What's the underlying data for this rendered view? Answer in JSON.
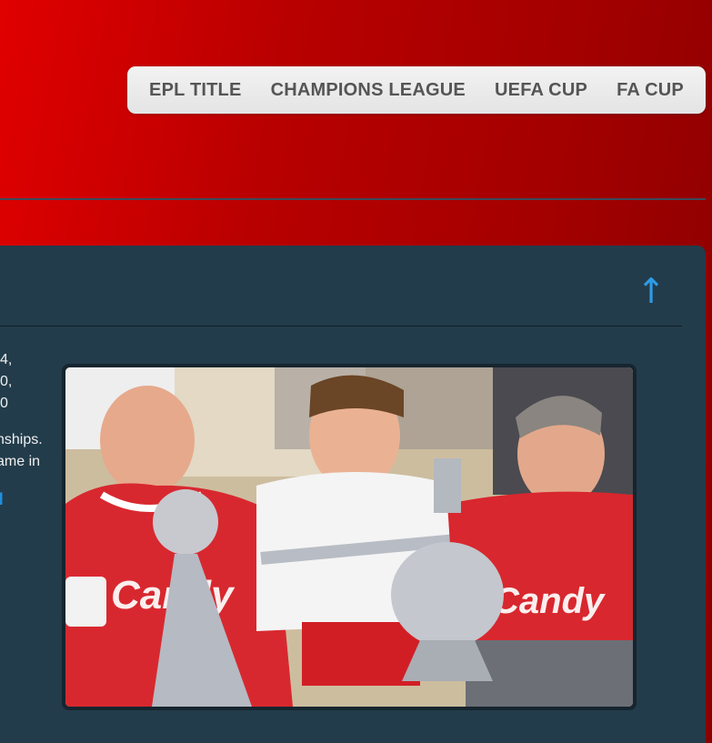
{
  "nav": {
    "items": [
      {
        "label": "EPL TITLE"
      },
      {
        "label": "CHAMPIONS LEAGUE"
      },
      {
        "label": "UEFA CUP"
      },
      {
        "label": "FA CUP"
      }
    ]
  },
  "panel": {
    "up_arrow": "↑",
    "text_lines": [
      "4,",
      "0,",
      "0"
    ],
    "paragraph_lines": [
      "nships.",
      "ame in"
    ],
    "link_text": "N",
    "photo_sponsor_left": "Candy",
    "photo_sponsor_right": "Candy"
  },
  "colors": {
    "header_red": "#c00000",
    "panel_bg": "#233c4b",
    "accent_blue": "#1e90e0",
    "nav_text": "#555555"
  }
}
